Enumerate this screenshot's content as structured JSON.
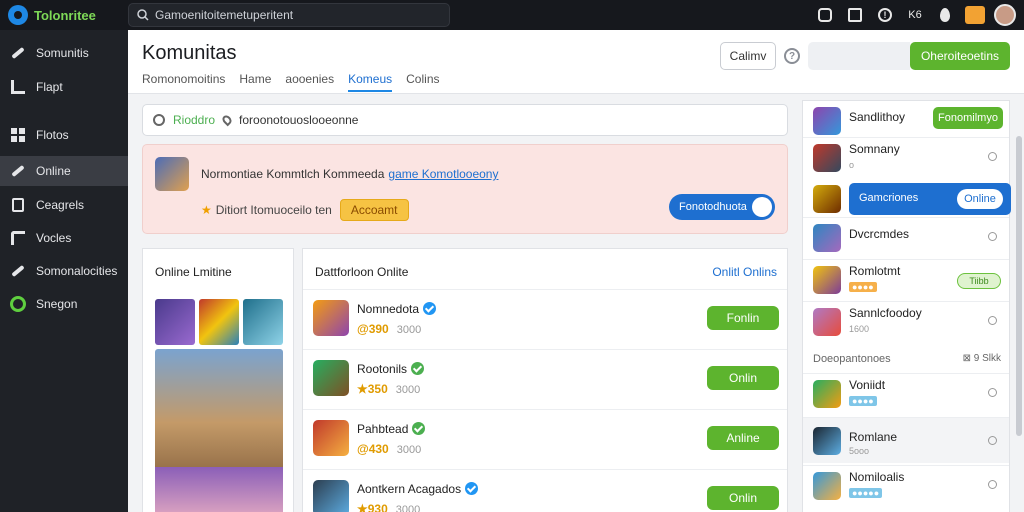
{
  "app": {
    "name": "Tolonritee"
  },
  "search": {
    "placeholder": "Gamoenitoitemetuperitent"
  },
  "topbar": {
    "icon_text": "K6"
  },
  "sidebar": {
    "items": [
      {
        "label": "Somunitis",
        "icon": "pen-icon"
      },
      {
        "label": "Flapt",
        "icon": "chart-icon"
      },
      {
        "label": "Flotos",
        "icon": "grid-icon"
      },
      {
        "label": "Online",
        "icon": "pen-icon",
        "active": true
      },
      {
        "label": "Ceagrels",
        "icon": "book-icon"
      },
      {
        "label": "Vocles",
        "icon": "tool-icon"
      },
      {
        "label": "Somonalocities",
        "icon": "pen-icon"
      },
      {
        "label": "Snegon",
        "icon": "green-circle-icon"
      }
    ]
  },
  "header": {
    "title": "Komunitas",
    "tabs": [
      "Romonomoitins",
      "Hame",
      "aooenies",
      "Komeus",
      "Colins"
    ],
    "active_tab": 3,
    "outline_button": "Calimv",
    "green_button": "Oheroiteoetins"
  },
  "filter": {
    "tag": "Rioddro",
    "text": "foroonotouoslooeonne"
  },
  "banner": {
    "line1": "Normontiae Kommtlch Kommeeda",
    "link": "game Komotlooeony",
    "line2": "Ditiort Itomuoceilo ten",
    "account_button": "Accoamt",
    "toggle_label": "Fonotodhuota"
  },
  "left_panel": {
    "title": "Online Lmitine"
  },
  "main_panel": {
    "title": "Dattforloon Onlite",
    "link": "Onlitl Onlins",
    "friends": [
      {
        "name": "Nomnedota",
        "coins": "@390",
        "sub": "3000",
        "button": "Fonlin",
        "badge_color": "#2196f3"
      },
      {
        "name": "Rootonils",
        "coins": "★350",
        "sub": "3000",
        "button": "Onlin",
        "badge_color": "#4caf50"
      },
      {
        "name": "Pahbtead",
        "coins": "@430",
        "sub": "3000",
        "button": "Anline",
        "badge_color": "#4caf50"
      },
      {
        "name": "Aontkern Acagados",
        "coins": "★930",
        "sub": "3000",
        "button": "Onlin",
        "badge_color": "#2196f3"
      }
    ]
  },
  "right_panel": {
    "top_row": {
      "name": "Sandlithoy",
      "button": "Fonomilmyo"
    },
    "rows": [
      {
        "name": "Somnany",
        "sub": "o"
      },
      {
        "name": "Gamcriones",
        "pill": "Online"
      },
      {
        "name": "Dvcrcmdes",
        "sub": ""
      },
      {
        "name": "Romlotmt",
        "sub": "●●●●",
        "badge": "Tiibb"
      },
      {
        "name": "Sannlcfoodoy",
        "sub": "1600"
      }
    ],
    "section": {
      "left": "Doeopantonoes",
      "right": "⊠ 9 Slkk"
    },
    "bottom_rows": [
      {
        "name": "Voniidt",
        "sub": "●●●●"
      },
      {
        "name": "Romlane",
        "sub": "5ooo"
      },
      {
        "name": "Nomiloalis",
        "sub": "●●●●●"
      }
    ]
  }
}
